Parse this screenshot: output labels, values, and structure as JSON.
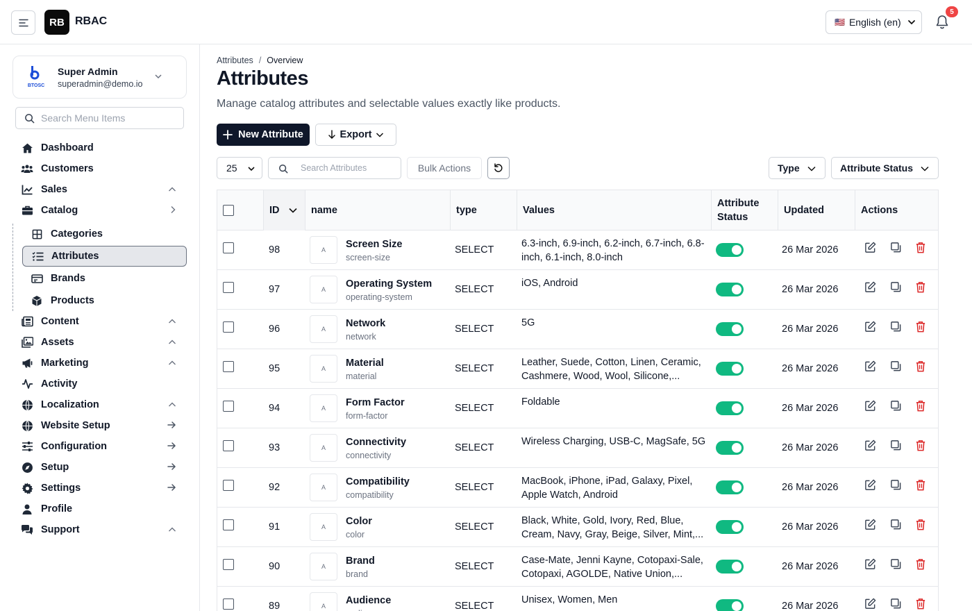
{
  "app": {
    "logo": "RB",
    "name": "RBAC"
  },
  "language": {
    "flag": "🇺🇸",
    "label": "English (en)"
  },
  "notifications": {
    "count": "5"
  },
  "user": {
    "logo_text": "BTOSC",
    "name": "Super Admin",
    "email": "superadmin@demo.io"
  },
  "menu_search": {
    "placeholder": "Search Menu Items"
  },
  "nav": [
    {
      "label": "Dashboard",
      "icon": "home-icon",
      "trail": ""
    },
    {
      "label": "Customers",
      "icon": "users-icon",
      "trail": ""
    },
    {
      "label": "Sales",
      "icon": "chart-line-icon",
      "trail": "chevron-up"
    },
    {
      "label": "Catalog",
      "icon": "briefcase-icon",
      "trail": "chevron-right"
    },
    {
      "label": "Content",
      "icon": "newspaper-icon",
      "trail": "chevron-up"
    },
    {
      "label": "Assets",
      "icon": "images-icon",
      "trail": "chevron-up"
    },
    {
      "label": "Marketing",
      "icon": "megaphone-icon",
      "trail": "chevron-up"
    },
    {
      "label": "Activity",
      "icon": "activity-icon",
      "trail": ""
    },
    {
      "label": "Localization",
      "icon": "globe-icon",
      "trail": "chevron-up"
    },
    {
      "label": "Website Setup",
      "icon": "globe-icon",
      "trail": "arrow-right"
    },
    {
      "label": "Configuration",
      "icon": "sliders-icon",
      "trail": "arrow-right"
    },
    {
      "label": "Setup",
      "icon": "compass-icon",
      "trail": "arrow-right"
    },
    {
      "label": "Settings",
      "icon": "gear-icon",
      "trail": "arrow-right"
    },
    {
      "label": "Profile",
      "icon": "user-icon",
      "trail": ""
    },
    {
      "label": "Support",
      "icon": "chat-icon",
      "trail": "chevron-up"
    }
  ],
  "catalog_sub": [
    {
      "label": "Categories",
      "icon": "grid-icon",
      "active": false
    },
    {
      "label": "Attributes",
      "icon": "list-check-icon",
      "active": true
    },
    {
      "label": "Brands",
      "icon": "tag-icon",
      "active": false
    },
    {
      "label": "Products",
      "icon": "cube-icon",
      "active": false
    }
  ],
  "breadcrumb": {
    "parent": "Attributes",
    "separator": "/",
    "current": "Overview"
  },
  "page": {
    "title": "Attributes",
    "subtitle": "Manage catalog attributes and selectable values exactly like products."
  },
  "toolbar": {
    "new_label": "New Attribute",
    "export_label": "Export",
    "per_page": "25",
    "search_placeholder": "Search Attributes",
    "bulk_label": "Bulk Actions",
    "filter_type": "Type",
    "filter_status": "Attribute Status"
  },
  "table": {
    "headers": {
      "id": "ID",
      "name": "name",
      "type": "type",
      "values": "Values",
      "status_1": "Attribute",
      "status_2": "Status",
      "updated": "Updated",
      "actions": "Actions"
    },
    "rows": [
      {
        "id": "98",
        "thumb": "A",
        "name": "Screen Size",
        "slug": "screen-size",
        "type": "SELECT",
        "values": "6.3-inch, 6.9-inch, 6.2-inch, 6.7-inch, 6.8-inch, 6.1-inch, 8.0-inch",
        "updated": "26 Mar 2026",
        "active": true
      },
      {
        "id": "97",
        "thumb": "A",
        "name": "Operating System",
        "slug": "operating-system",
        "type": "SELECT",
        "values": "iOS, Android",
        "updated": "26 Mar 2026",
        "active": true
      },
      {
        "id": "96",
        "thumb": "A",
        "name": "Network",
        "slug": "network",
        "type": "SELECT",
        "values": "5G",
        "updated": "26 Mar 2026",
        "active": true
      },
      {
        "id": "95",
        "thumb": "A",
        "name": "Material",
        "slug": "material",
        "type": "SELECT",
        "values": "Leather, Suede, Cotton, Linen, Ceramic, Cashmere, Wood, Wool, Silicone,...",
        "updated": "26 Mar 2026",
        "active": true
      },
      {
        "id": "94",
        "thumb": "A",
        "name": "Form Factor",
        "slug": "form-factor",
        "type": "SELECT",
        "values": "Foldable",
        "updated": "26 Mar 2026",
        "active": true
      },
      {
        "id": "93",
        "thumb": "A",
        "name": "Connectivity",
        "slug": "connectivity",
        "type": "SELECT",
        "values": "Wireless Charging, USB-C, MagSafe, 5G",
        "updated": "26 Mar 2026",
        "active": true
      },
      {
        "id": "92",
        "thumb": "A",
        "name": "Compatibility",
        "slug": "compatibility",
        "type": "SELECT",
        "values": "MacBook, iPhone, iPad, Galaxy, Pixel, Apple Watch, Android",
        "updated": "26 Mar 2026",
        "active": true
      },
      {
        "id": "91",
        "thumb": "A",
        "name": "Color",
        "slug": "color",
        "type": "SELECT",
        "values": "Black, White, Gold, Ivory, Red, Blue, Cream, Navy, Gray, Beige, Silver, Mint,...",
        "updated": "26 Mar 2026",
        "active": true
      },
      {
        "id": "90",
        "thumb": "A",
        "name": "Brand",
        "slug": "brand",
        "type": "SELECT",
        "values": "Case-Mate, Jenni Kayne, Cotopaxi-Sale, Cotopaxi, AGOLDE, Native Union,...",
        "updated": "26 Mar 2026",
        "active": true
      },
      {
        "id": "89",
        "thumb": "A",
        "name": "Audience",
        "slug": "audience",
        "type": "SELECT",
        "values": "Unisex, Women, Men",
        "updated": "26 Mar 2026",
        "active": true
      }
    ]
  },
  "colors": {
    "accent": "#0f172a",
    "toggle_on": "#10b981",
    "danger": "#dc2626",
    "badge": "#ef4444"
  }
}
